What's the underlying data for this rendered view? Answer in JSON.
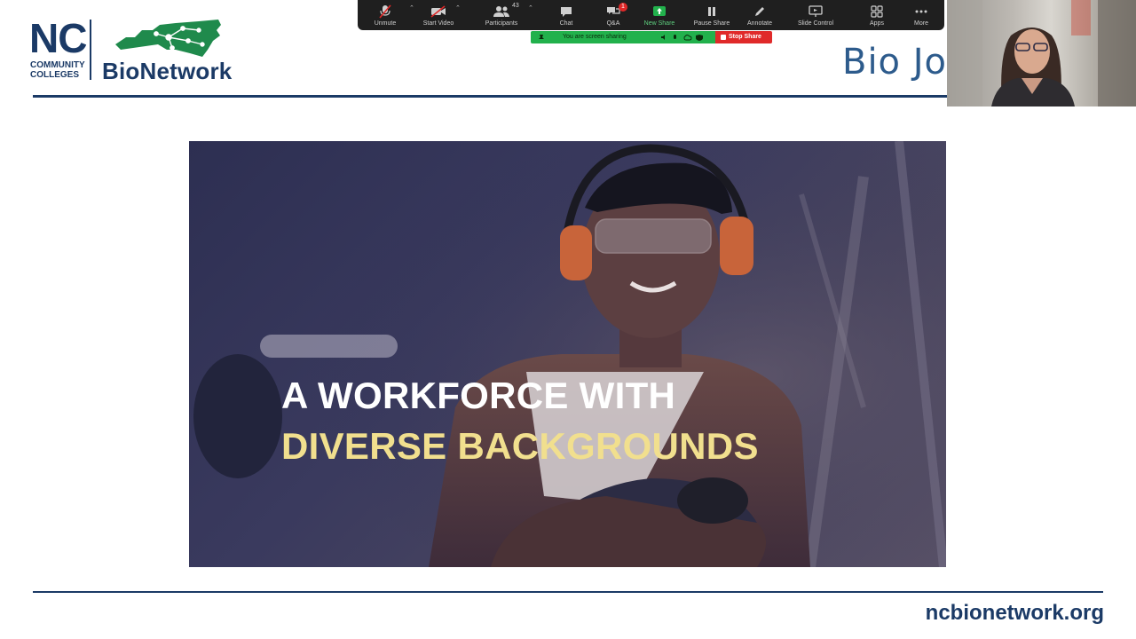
{
  "logo": {
    "nc": "NC",
    "community": "COMMUNITY",
    "colleges": "COLLEGES",
    "name": "BioNetwork"
  },
  "slide": {
    "title": "Bio Jo",
    "hero_line1": "A WORKFORCE WITH",
    "hero_line2": "DIVERSE BACKGROUNDS",
    "footer_url": "ncbionetwork.org"
  },
  "toolbar": {
    "unmute": "Unmute",
    "start_video": "Start Video",
    "participants": "Participants",
    "participant_count": "43",
    "chat": "Chat",
    "qa": "Q&A",
    "qa_badge": "1",
    "new_share": "New Share",
    "pause_share": "Pause Share",
    "annotate": "Annotate",
    "slide_control": "Slide Control",
    "apps": "Apps",
    "more": "More"
  },
  "sharing": {
    "status": "You are screen sharing",
    "stop": "Stop Share"
  },
  "colors": {
    "brand_navy": "#1b3a66",
    "brand_green": "#1f8a4c",
    "hero_highlight": "#f1df8e",
    "share_green": "#22b14c",
    "share_red": "#e02a2a"
  }
}
